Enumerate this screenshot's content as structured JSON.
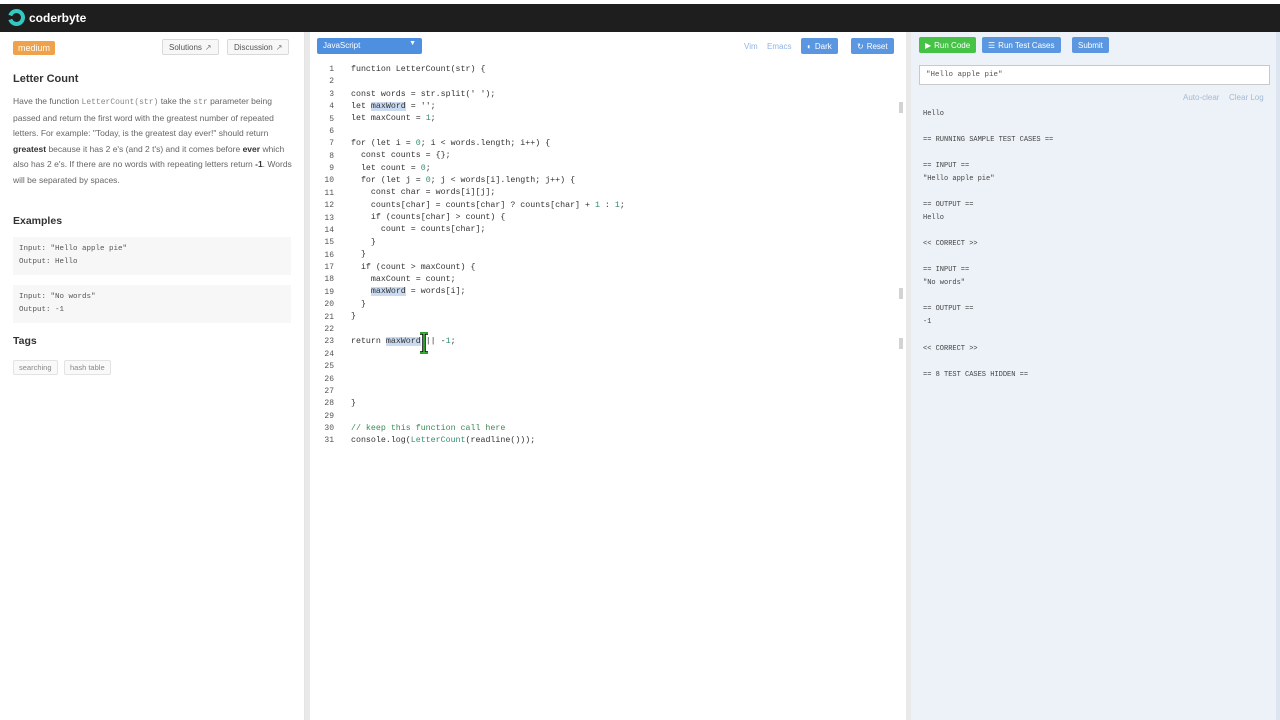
{
  "app": {
    "brand": "coderbyte"
  },
  "problem": {
    "difficulty": "medium",
    "solutions_label": "Solutions",
    "discussion_label": "Discussion",
    "title": "Letter Count",
    "desc_1": "Have the function ",
    "desc_fn": "LetterCount(str)",
    "desc_2": " take the ",
    "desc_param": "str",
    "desc_3": " parameter being passed and return the first word with the greatest number of repeated letters. For example: \"Today, is the greatest day ever!\" should return ",
    "desc_bold1": "greatest",
    "desc_4": " because it has 2 e's (and 2 t's) and it comes before ",
    "desc_bold2": "ever",
    "desc_5": " which also has 2 e's. If there are no words with repeating letters return ",
    "desc_bold3": "-1",
    "desc_6": ". Words will be separated by spaces.",
    "examples_heading": "Examples",
    "examples": [
      {
        "input": "Input: \"Hello apple pie\"",
        "output": "Output: Hello"
      },
      {
        "input": "Input: \"No words\"",
        "output": "Output: -1"
      }
    ],
    "tags_heading": "Tags",
    "tags": [
      "searching",
      "hash table"
    ]
  },
  "editor": {
    "language": "JavaScript",
    "mode_vim": "Vim",
    "mode_emacs": "Emacs",
    "theme_button": "Dark",
    "reset_button": "Reset",
    "line_numbers": [
      "1",
      "2",
      "3",
      "4",
      "5",
      "6",
      "7",
      "8",
      "9",
      "10",
      "11",
      "12",
      "13",
      "14",
      "15",
      "16",
      "17",
      "18",
      "19",
      "20",
      "21",
      "22",
      "23",
      "24",
      "25",
      "26",
      "27",
      "28",
      "29",
      "30",
      "31"
    ]
  },
  "console": {
    "run_code": "Run Code",
    "run_tests": "Run Test Cases",
    "submit": "Submit",
    "input_value": "\"Hello apple pie\"",
    "auto_clear": "Auto-clear",
    "clear_log": "Clear Log",
    "lines": [
      "Hello",
      "== RUNNING SAMPLE TEST CASES ==",
      "== INPUT ==",
      "\"Hello apple pie\"",
      "== OUTPUT ==",
      "Hello",
      "<< CORRECT >>",
      "== INPUT ==",
      "\"No words\"",
      "== OUTPUT ==",
      "-1",
      "<< CORRECT >>",
      "== 8 TEST CASES HIDDEN =="
    ]
  },
  "colors": {
    "accent_blue": "#5b97e1",
    "run_green": "#46c246",
    "difficulty_orange": "#f0a24a",
    "topbar": "#1e1e1e"
  }
}
